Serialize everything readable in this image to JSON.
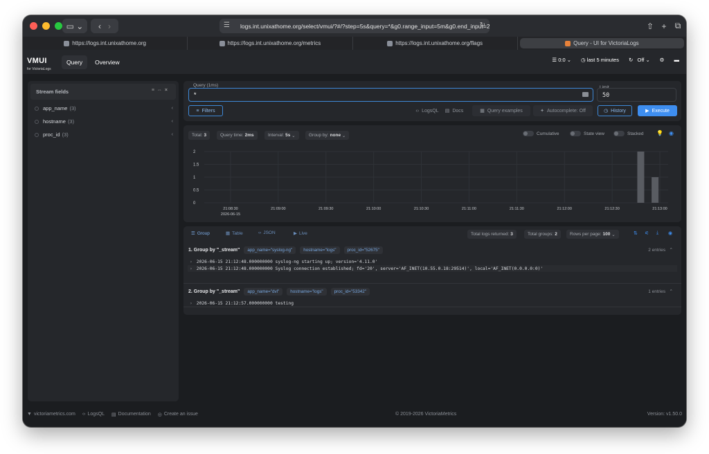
{
  "browser": {
    "url": "logs.int.unixathome.org/select/vmui/?#/?step=5s&query=*&g0.range_input=5m&g0.end_input=2",
    "tabs": [
      {
        "label": "https://logs.int.unixathome.org"
      },
      {
        "label": "https://logs.int.unixathome.org/metrics"
      },
      {
        "label": "https://logs.int.unixathome.org/flags"
      },
      {
        "label": "Query - UI for VictoriaLogs"
      }
    ]
  },
  "header": {
    "logo_main": "VMUI",
    "logo_sub": "for VictoriaLogs",
    "nav": [
      "Query",
      "Overview"
    ],
    "tenant": "0:0",
    "time_range": "last 5 minutes",
    "refresh": "Off"
  },
  "sidebar": {
    "title": "Stream fields",
    "items": [
      {
        "name": "app_name",
        "count": "(3)"
      },
      {
        "name": "hostname",
        "count": "(3)"
      },
      {
        "name": "proc_id",
        "count": "(3)"
      }
    ]
  },
  "query": {
    "label": "Query (1ms)",
    "value": "*",
    "limit_label": "Limit",
    "limit_value": "50",
    "filters": "Filters",
    "logsql": "LogsQL",
    "docs": "Docs",
    "examples": "Query examples",
    "autocomplete": "Autocomplete: Off",
    "history": "History",
    "execute": "Execute"
  },
  "chart_toolbar": {
    "total_label": "Total:",
    "total": "3",
    "qtime_label": "Query time:",
    "qtime": "2ms",
    "interval_label": "Interval:",
    "interval": "5s",
    "groupby_label": "Group by:",
    "groupby": "none",
    "cumulative": "Cumulative",
    "state_view": "State view",
    "stacked": "Stacked"
  },
  "chart_data": {
    "type": "bar",
    "x_ticks": [
      "21:08:30",
      "21:09:00",
      "21:09:30",
      "21:10:00",
      "21:10:30",
      "21:11:00",
      "21:11:30",
      "21:12:00",
      "21:12:30",
      "21:13:00"
    ],
    "x_date": "2026-06-15",
    "y_ticks": [
      "2",
      "1.5",
      "1",
      "0.5",
      "0"
    ],
    "ylim": [
      0,
      2
    ],
    "bars": [
      {
        "x": "21:12:48",
        "value": 2
      },
      {
        "x": "21:12:57",
        "value": 1
      }
    ],
    "grid": true
  },
  "results": {
    "tabs": [
      "Group",
      "Table",
      "JSON",
      "Live"
    ],
    "total_returned_label": "Total logs returned:",
    "total_returned": "3",
    "total_groups_label": "Total groups:",
    "total_groups": "2",
    "rows_per_page_label": "Rows per page:",
    "rows_per_page": "100",
    "groups": [
      {
        "title": "1. Group by \"_stream\"",
        "chips": [
          "app_name=\"syslog-ng\"",
          "hostname=\"logs\"",
          "proc_id=\"52675\""
        ],
        "entries": "2 entries",
        "lines": [
          "2026-06-15 21:12:48.000000000  syslog-ng starting up; version='4.11.0'",
          "2026-06-15 21:12:48.000000000  Syslog connection established; fd='20', server='AF_INET(10.55.0.18:29514)', local='AF_INET(0.0.0.0:0)'"
        ]
      },
      {
        "title": "2. Group by \"_stream\"",
        "chips": [
          "app_name=\"dvl\"",
          "hostname=\"logs\"",
          "proc_id=\"53342\""
        ],
        "entries": "1 entries",
        "lines": [
          "2026-06-15 21:12:57.000000000  testing"
        ]
      }
    ]
  },
  "footer": {
    "site": "victoriametrics.com",
    "logsql": "LogsQL",
    "docs": "Documentation",
    "issue": "Create an issue",
    "copyright": "© 2019-2026 VictoriaMetrics",
    "version": "Version: v1.50.0"
  },
  "colors": {
    "accent": "#3e8ef0",
    "background": "#1b1d20",
    "panel": "#25272b",
    "bar": "#595c62"
  }
}
